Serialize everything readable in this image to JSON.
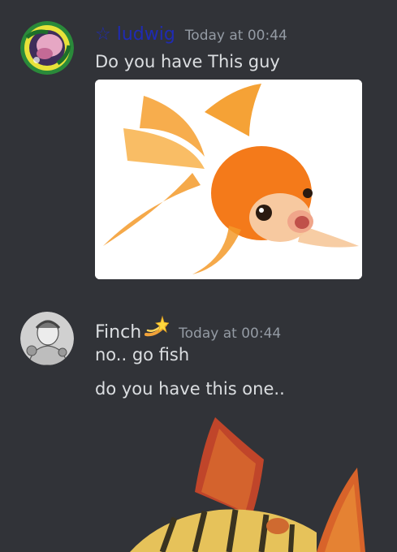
{
  "messages": [
    {
      "username": "☆ ludwig",
      "timestamp": "Today at 00:44",
      "lines": [
        "Do you have This guy"
      ],
      "username_color": "#1f2bb3"
    },
    {
      "username": "Finch",
      "timestamp": "Today at 00:44",
      "lines": [
        "no.. go fish",
        "do you have this one.."
      ],
      "username_color": "#dbdee1"
    }
  ],
  "icons": {
    "finch_badge": "dizzy-star-icon"
  },
  "colors": {
    "background": "#313338",
    "text": "#dbdee1",
    "timestamp": "#949ba4"
  }
}
